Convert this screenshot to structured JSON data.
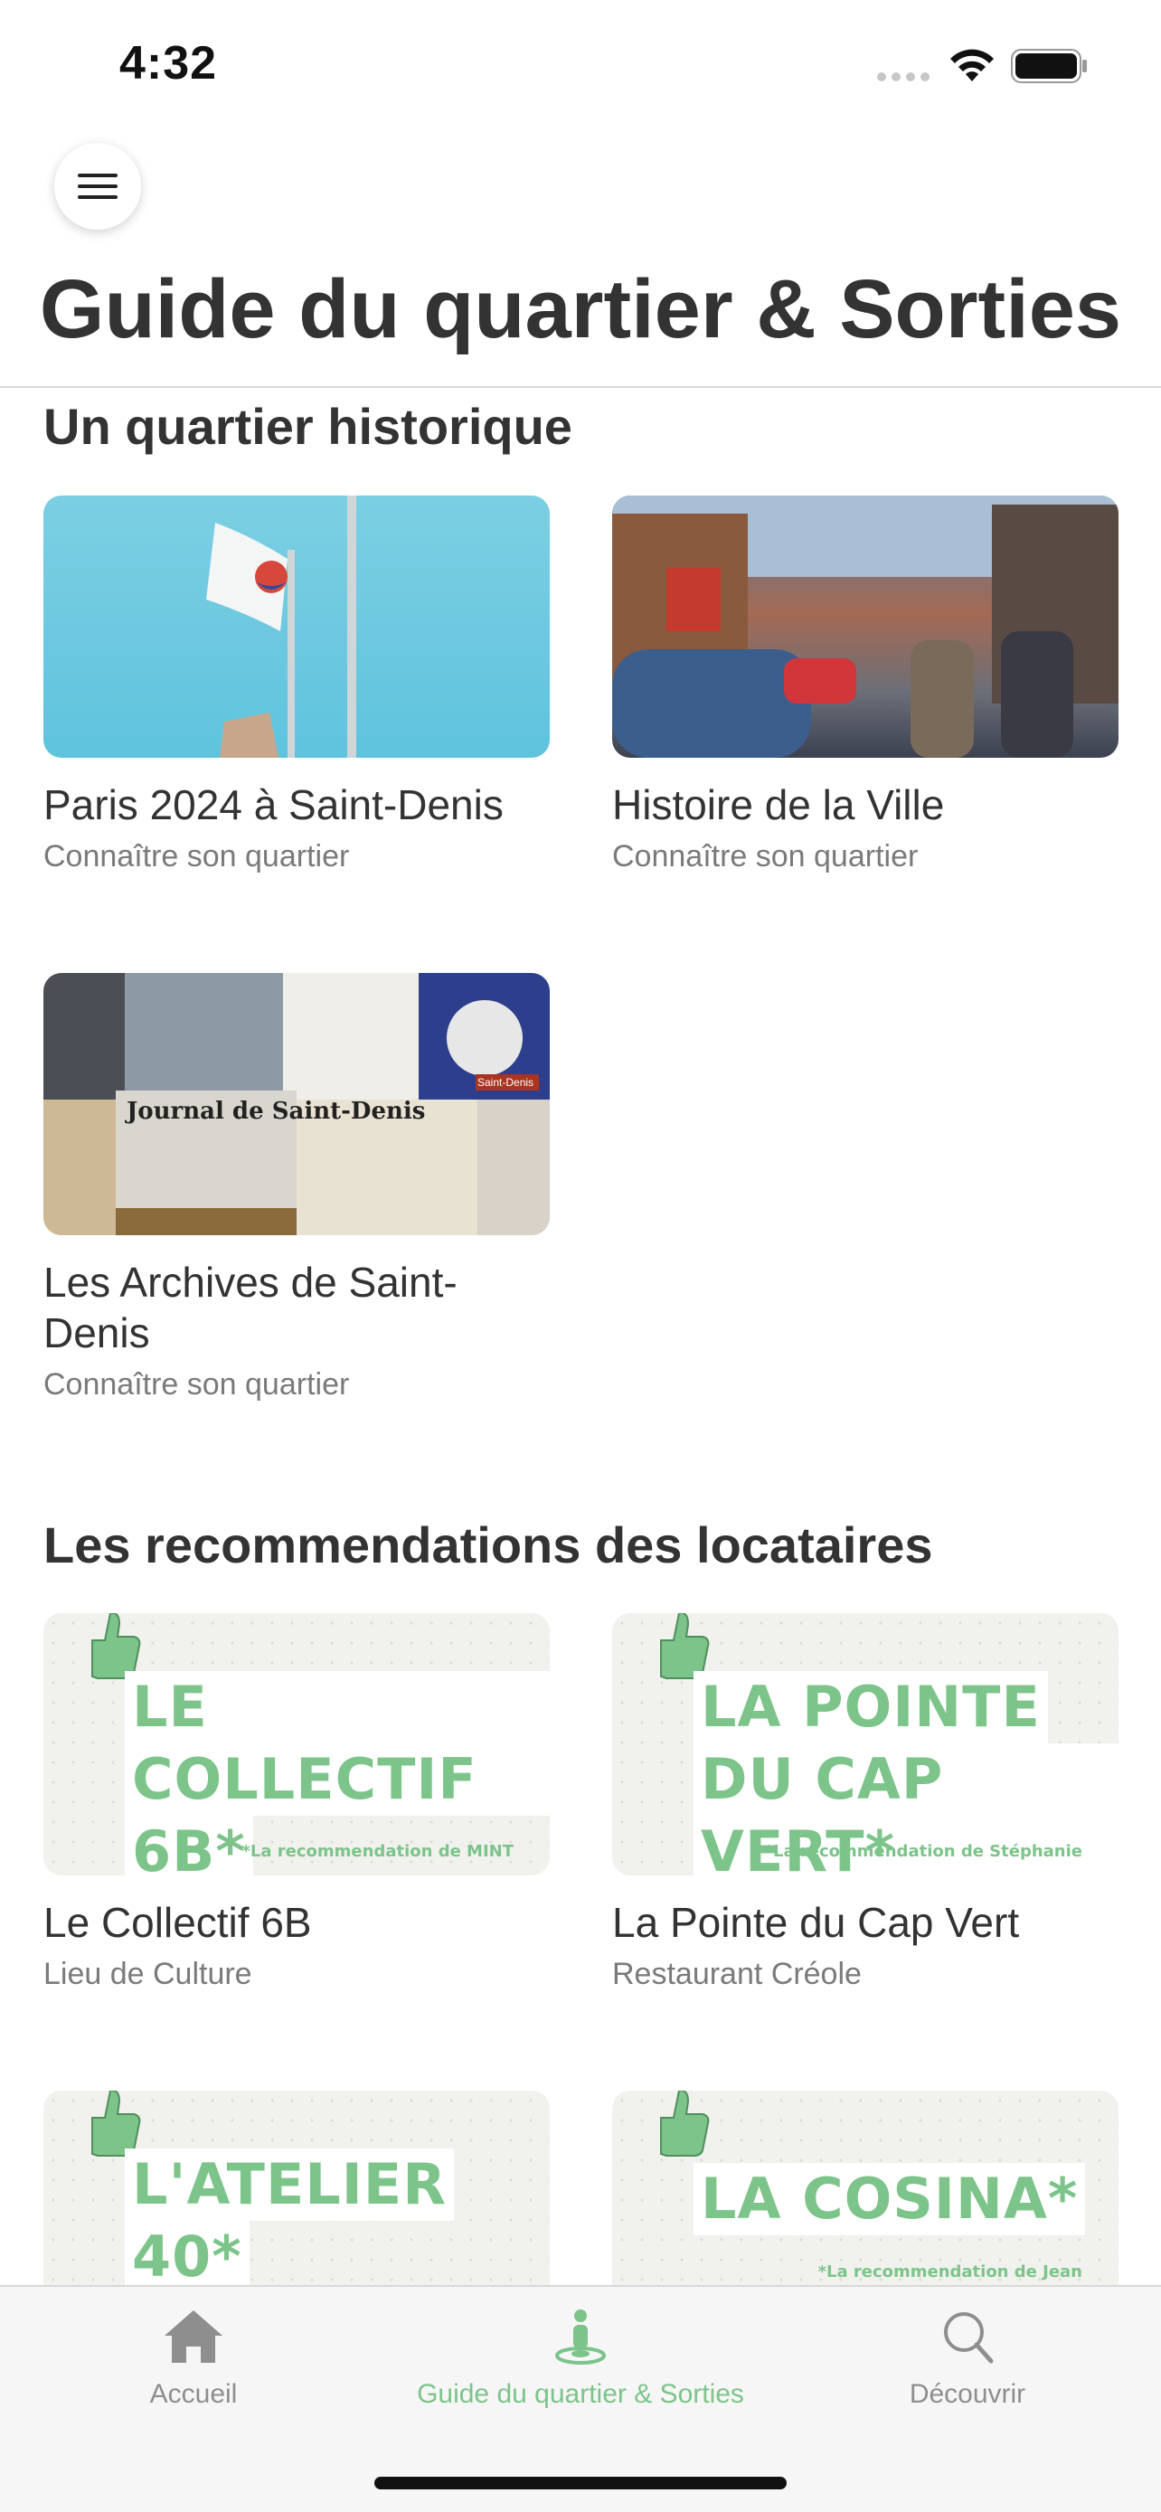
{
  "status_bar": {
    "time": "4:32"
  },
  "header": {
    "title": "Guide du quartier & Sorties"
  },
  "sections": [
    {
      "title": "Un quartier historique",
      "cards": [
        {
          "title": "Paris 2024 à Saint-Denis",
          "subtitle": "Connaître son quartier"
        },
        {
          "title": "Histoire de la Ville",
          "subtitle": "Connaître son quartier"
        },
        {
          "title": "Les Archives de Saint-Denis",
          "subtitle": "Connaître son quartier"
        }
      ]
    },
    {
      "title": "Les recommendations des locataires",
      "cards": [
        {
          "title": "Le Collectif 6B",
          "subtitle": "Lieu de Culture",
          "poster_lines": [
            "LE COLLECTIF",
            "6B*"
          ],
          "poster_note": "*La recommendation de MINT"
        },
        {
          "title": "La Pointe du Cap Vert",
          "subtitle": "Restaurant Créole",
          "poster_lines": [
            "LA POINTE",
            "DU CAP VERT*"
          ],
          "poster_note": "*La recommendation de Stéphanie"
        },
        {
          "poster_lines": [
            "L'ATELIER",
            "40*"
          ]
        },
        {
          "poster_lines": [
            "LA COSINA*"
          ],
          "poster_note": "*La recommendation de Jean"
        }
      ]
    }
  ],
  "archives_image_text": [
    "Journal de Saint-Denis",
    "Saint-Denis"
  ],
  "tab_bar": {
    "tabs": [
      {
        "label": "Accueil",
        "icon": "home-icon"
      },
      {
        "label": "Guide du quartier & Sorties",
        "icon": "person-location-icon",
        "active": true
      },
      {
        "label": "Découvrir",
        "icon": "search-icon"
      }
    ]
  },
  "colors": {
    "accent": "#7cc48a",
    "text": "#333333",
    "muted": "#7a7a7a"
  }
}
